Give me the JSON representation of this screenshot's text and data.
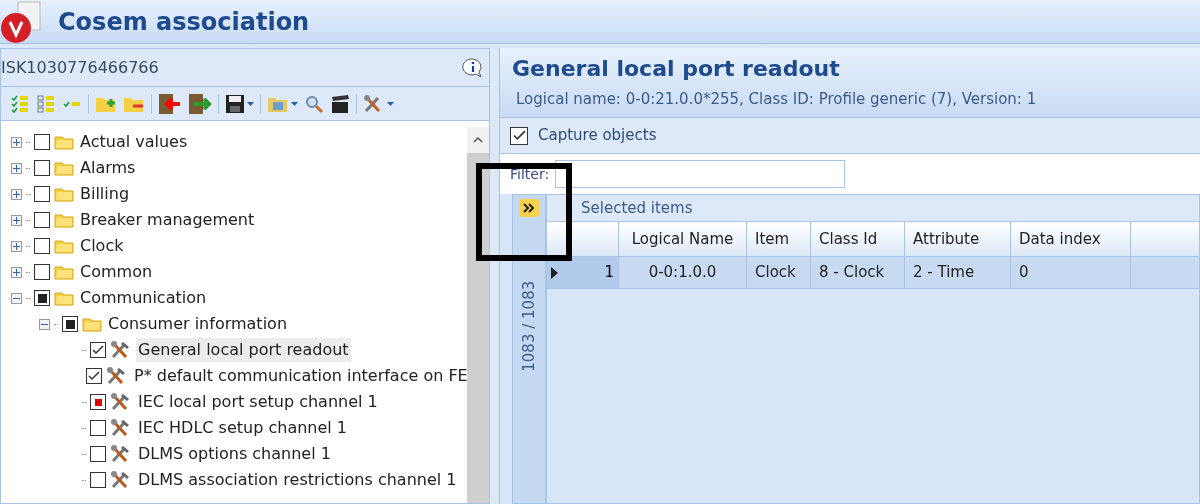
{
  "window": {
    "title": "Cosem association"
  },
  "device": {
    "id": "ISK1030776466766"
  },
  "tree": [
    {
      "label": "Actual values",
      "checked": false,
      "partial": false,
      "error": false,
      "expanded": false,
      "kind": "folder"
    },
    {
      "label": "Alarms",
      "checked": false,
      "partial": false,
      "error": false,
      "expanded": false,
      "kind": "folder"
    },
    {
      "label": "Billing",
      "checked": false,
      "partial": false,
      "error": false,
      "expanded": false,
      "kind": "folder"
    },
    {
      "label": "Breaker management",
      "checked": false,
      "partial": false,
      "error": false,
      "expanded": false,
      "kind": "folder"
    },
    {
      "label": "Clock",
      "checked": false,
      "partial": false,
      "error": false,
      "expanded": false,
      "kind": "folder"
    },
    {
      "label": "Common",
      "checked": false,
      "partial": false,
      "error": false,
      "expanded": false,
      "kind": "folder"
    },
    {
      "label": "Communication",
      "checked": false,
      "partial": true,
      "error": false,
      "expanded": true,
      "kind": "folder",
      "children": [
        {
          "label": "Consumer information",
          "checked": false,
          "partial": true,
          "error": false,
          "expanded": true,
          "kind": "folder",
          "children": [
            {
              "label": "General local port readout",
              "checked": true,
              "partial": false,
              "error": false,
              "kind": "object",
              "selected": true
            },
            {
              "label": "P* default communication interface on FE",
              "checked": true,
              "partial": false,
              "error": false,
              "kind": "object",
              "selected": false
            },
            {
              "label": "IEC local port setup channel 1",
              "checked": false,
              "partial": false,
              "error": true,
              "kind": "object",
              "selected": false
            },
            {
              "label": "IEC HDLC setup channel 1",
              "checked": false,
              "partial": false,
              "error": false,
              "kind": "object",
              "selected": false
            },
            {
              "label": "DLMS options channel 1",
              "checked": false,
              "partial": false,
              "error": false,
              "kind": "object",
              "selected": false
            },
            {
              "label": "DLMS association restrictions channel 1",
              "checked": false,
              "partial": false,
              "error": false,
              "kind": "object",
              "selected": false
            }
          ]
        }
      ]
    }
  ],
  "detail": {
    "title": "General local port readout",
    "subtitle": "Logical name: 0-0:21.0.0*255, Class ID: Profile generic (7), Version: 1",
    "capture": {
      "label": "Capture objects",
      "checked": true
    },
    "filter": {
      "label": "Filter:"
    },
    "side_tab": {
      "label": "1083 / 1083"
    },
    "group_title": "Selected items",
    "table": {
      "columns": [
        "Logical Name",
        "Item",
        "Class Id",
        "Attribute",
        "Data index"
      ],
      "rows": [
        {
          "number": "1",
          "current": true,
          "cells": [
            "0-0:1.0.0",
            "Clock",
            "8 - Clock",
            "2 - Time",
            "0"
          ]
        }
      ]
    }
  }
}
